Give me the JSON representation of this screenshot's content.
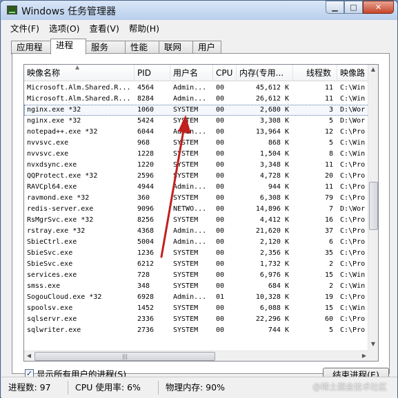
{
  "window": {
    "title": "Windows 任务管理器"
  },
  "menu": [
    "文件(F)",
    "选项(O)",
    "查看(V)",
    "帮助(H)"
  ],
  "tabs": [
    {
      "label": "应用程序",
      "active": false
    },
    {
      "label": "进程",
      "active": true
    },
    {
      "label": "服务",
      "active": false
    },
    {
      "label": "性能",
      "active": false
    },
    {
      "label": "联网",
      "active": false
    },
    {
      "label": "用户",
      "active": false
    }
  ],
  "columns": [
    "映像名称",
    "PID",
    "用户名",
    "CPU",
    "内存(专用...",
    "线程数",
    "映像路"
  ],
  "rows": [
    [
      "Microsoft.Alm.Shared.R...",
      "4564",
      "Admin...",
      "00",
      "45,612 K",
      "11",
      "C:\\Win"
    ],
    [
      "Microsoft.Alm.Shared.R...",
      "8284",
      "Admin...",
      "00",
      "26,612 K",
      "11",
      "C:\\Win"
    ],
    [
      "nginx.exe *32",
      "1060",
      "SYSTEM",
      "00",
      "2,680 K",
      "3",
      "D:\\Wor"
    ],
    [
      "nginx.exe *32",
      "5424",
      "SYSTEM",
      "00",
      "3,308 K",
      "5",
      "D:\\Wor"
    ],
    [
      "notepad++.exe *32",
      "6044",
      "Admin...",
      "00",
      "13,964 K",
      "12",
      "C:\\Pro"
    ],
    [
      "nvvsvc.exe",
      "968",
      "SYSTEM",
      "00",
      "868 K",
      "5",
      "C:\\Win"
    ],
    [
      "nvvsvc.exe",
      "1228",
      "SYSTEM",
      "00",
      "1,504 K",
      "8",
      "C:\\Win"
    ],
    [
      "nvxdsync.exe",
      "1220",
      "SYSTEM",
      "00",
      "3,348 K",
      "11",
      "C:\\Pro"
    ],
    [
      "QQProtect.exe *32",
      "2596",
      "SYSTEM",
      "00",
      "4,728 K",
      "20",
      "C:\\Pro"
    ],
    [
      "RAVCpl64.exe",
      "4944",
      "Admin...",
      "00",
      "944 K",
      "11",
      "C:\\Pro"
    ],
    [
      "ravmond.exe *32",
      "360",
      "SYSTEM",
      "00",
      "6,308 K",
      "79",
      "C:\\Pro"
    ],
    [
      "redis-server.exe",
      "9096",
      "NETWO...",
      "00",
      "14,896 K",
      "7",
      "D:\\Wor"
    ],
    [
      "RsMgrSvc.exe *32",
      "8256",
      "SYSTEM",
      "00",
      "4,412 K",
      "16",
      "C:\\Pro"
    ],
    [
      "rstray.exe *32",
      "4368",
      "Admin...",
      "00",
      "21,620 K",
      "37",
      "C:\\Pro"
    ],
    [
      "SbieCtrl.exe",
      "5004",
      "Admin...",
      "00",
      "2,120 K",
      "6",
      "C:\\Pro"
    ],
    [
      "SbieSvc.exe",
      "1236",
      "SYSTEM",
      "00",
      "2,356 K",
      "35",
      "C:\\Pro"
    ],
    [
      "SbieSvc.exe",
      "6212",
      "SYSTEM",
      "00",
      "1,732 K",
      "2",
      "C:\\Pro"
    ],
    [
      "services.exe",
      "728",
      "SYSTEM",
      "00",
      "6,976 K",
      "15",
      "C:\\Win"
    ],
    [
      "smss.exe",
      "348",
      "SYSTEM",
      "00",
      "684 K",
      "2",
      "C:\\Win"
    ],
    [
      "SogouCloud.exe *32",
      "6928",
      "Admin...",
      "01",
      "10,328 K",
      "19",
      "C:\\Pro"
    ],
    [
      "spoolsv.exe",
      "1452",
      "SYSTEM",
      "00",
      "6,088 K",
      "15",
      "C:\\Win"
    ],
    [
      "sqlservr.exe",
      "2336",
      "SYSTEM",
      "00",
      "22,296 K",
      "60",
      "C:\\Pro"
    ],
    [
      "sqlwriter.exe",
      "2736",
      "SYSTEM",
      "00",
      "744 K",
      "5",
      "C:\\Pro"
    ]
  ],
  "selected_row": 2,
  "show_all_label": "显示所有用户的进程(S)",
  "show_all_checked": true,
  "end_process_label": "结束进程(E)",
  "status": {
    "processes": "进程数: 97",
    "cpu": "CPU 使用率: 6%",
    "memory": "物理内存: 90%"
  },
  "watermark": "@稀土掘金技术社区",
  "colors": {
    "arrow": "#c0201e",
    "selection_border": "#5b7aa5"
  }
}
